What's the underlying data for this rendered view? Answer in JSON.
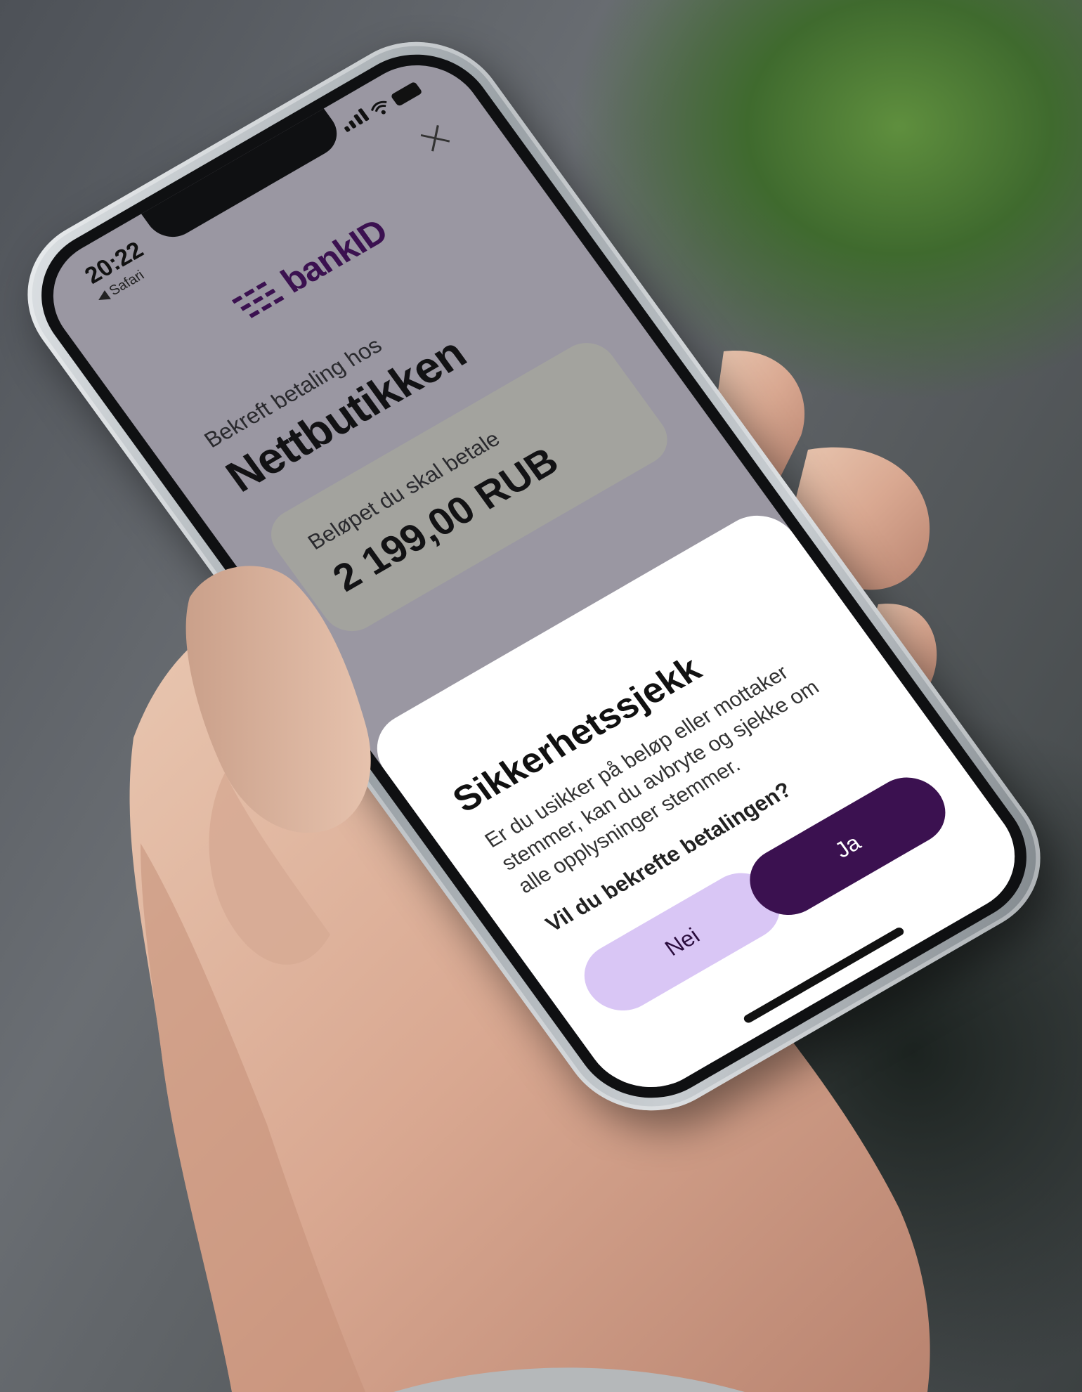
{
  "status_bar": {
    "time": "20:22",
    "back_label": "◀ Safari"
  },
  "header": {
    "logo_text": "bankID"
  },
  "confirm": {
    "subtitle": "Bekreft betaling hos",
    "merchant": "Nettbutikken"
  },
  "amount": {
    "label": "Beløpet du skal betale",
    "value": "2 199,00 RUB"
  },
  "security_sheet": {
    "title": "Sikkerhetssjekk",
    "body": "Er du usikker på beløp eller mottaker stemmer, kan du avbryte og sjekke om alle opplysninger stemmer.",
    "question": "Vil du bekrefte betalingen?",
    "no_label": "Nei",
    "yes_label": "Ja"
  },
  "colors": {
    "brand": "#3b1150",
    "no_button": "#d9c6f5",
    "screen_overlay": "#9a97a2",
    "amount_card": "#a3a39e"
  },
  "icons": [
    "close-icon",
    "signal-icon",
    "wifi-icon",
    "battery-icon",
    "bankid-logo-icon"
  ]
}
